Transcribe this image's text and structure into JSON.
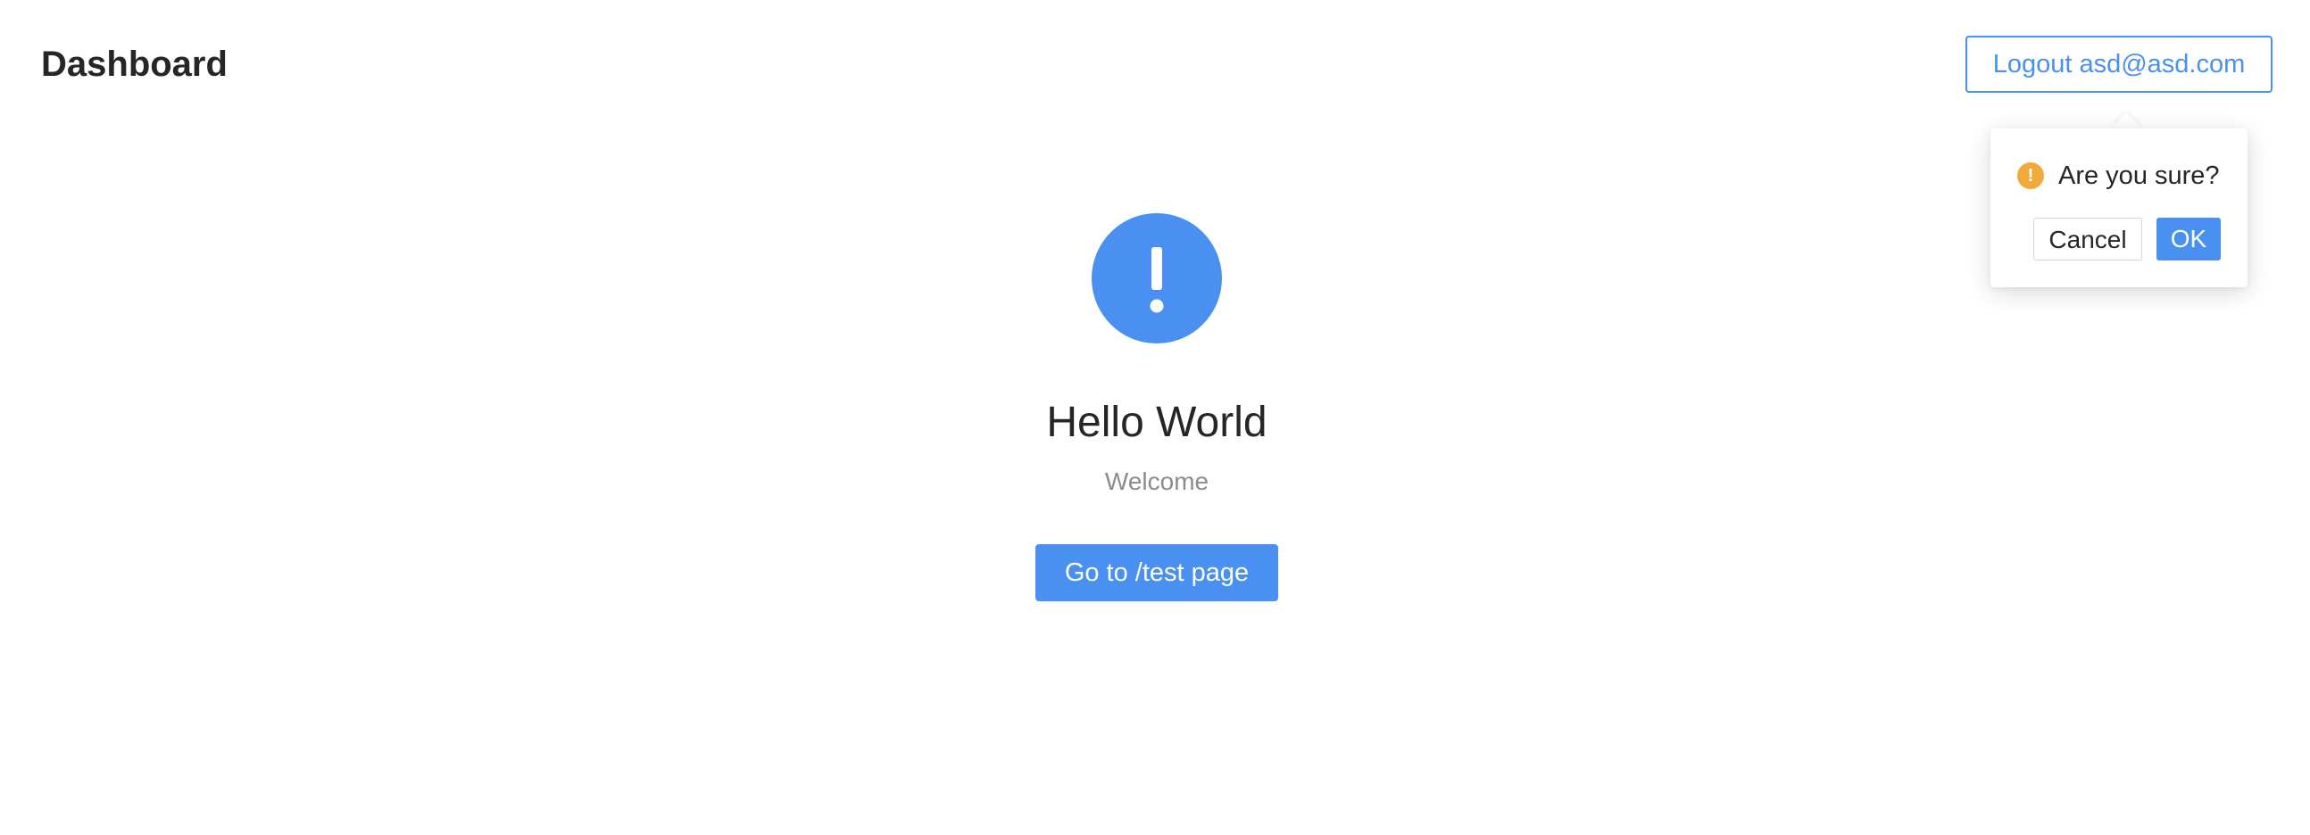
{
  "header": {
    "title": "Dashboard",
    "logout_label": "Logout asd@asd.com"
  },
  "popconfirm": {
    "icon": "exclamation-circle-icon",
    "icon_glyph": "!",
    "message": "Are you sure?",
    "cancel_label": "Cancel",
    "ok_label": "OK"
  },
  "result": {
    "icon": "info-exclamation-icon",
    "title": "Hello World",
    "subtitle": "Welcome",
    "action_label": "Go to /test page"
  },
  "colors": {
    "primary": "#4a90f0",
    "warning": "#f0a93a",
    "text": "#262626",
    "secondary_text": "#8c8c8c"
  }
}
